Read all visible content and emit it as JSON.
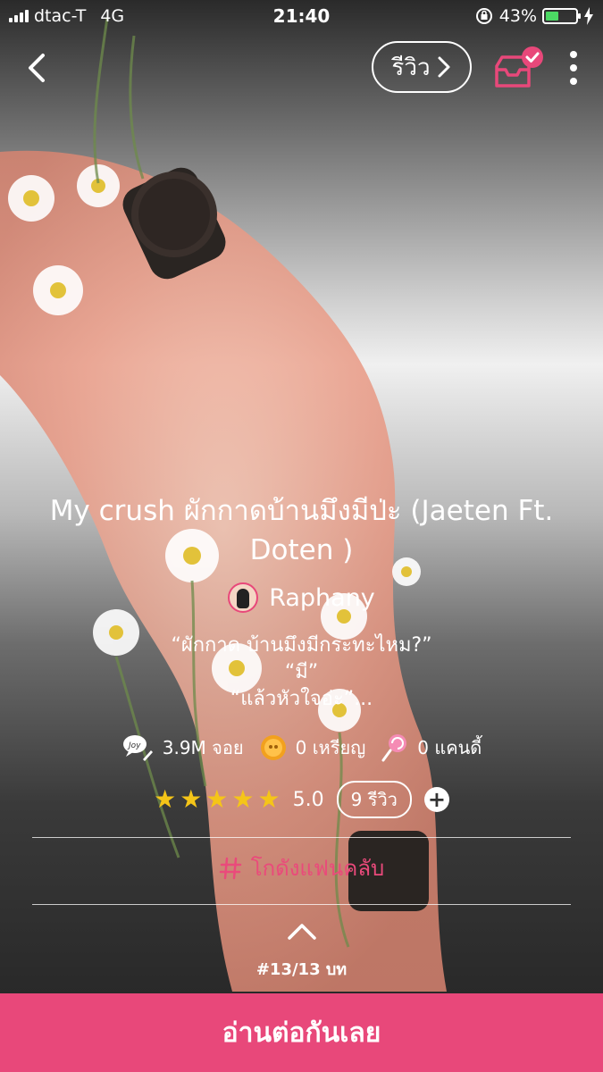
{
  "status_bar": {
    "carrier": "dtac-T",
    "network": "4G",
    "time": "21:40",
    "battery": "43%",
    "battery_level": 0.43
  },
  "header": {
    "review_button_label": "รีวิว"
  },
  "story": {
    "title": "My crush ผักกาดบ้านมึงมีป่ะ (Jaeten Ft. Doten )",
    "author": "Raphany",
    "synopsis_lines": [
      "“ผักกาด บ้านมึงมีกระทะไหม?”",
      "“มี”",
      "“แล้วหัวใจอ่ะ”..."
    ]
  },
  "stats": {
    "views": "3.9M จอย",
    "coins": "0 เหรียญ",
    "candies": "0 แคนดี้"
  },
  "rating": {
    "stars": 5,
    "score": "5.0",
    "reviews": "9 รีวิว"
  },
  "fanclub_label": "โกดังแฟนคลับ",
  "episode": "#13/13 บท",
  "cta_label": "อ่านต่อกันเลย",
  "colors": {
    "accent": "#E8487A",
    "star": "#F5C518",
    "battery": "#4CD964"
  },
  "icons": [
    "back-chevron-icon",
    "chevron-right-icon",
    "library-check-icon",
    "more-vertical-icon",
    "joy-icon",
    "coin-icon",
    "candy-icon",
    "star-icon",
    "plus-icon",
    "hash-icon",
    "chevron-up-icon"
  ]
}
